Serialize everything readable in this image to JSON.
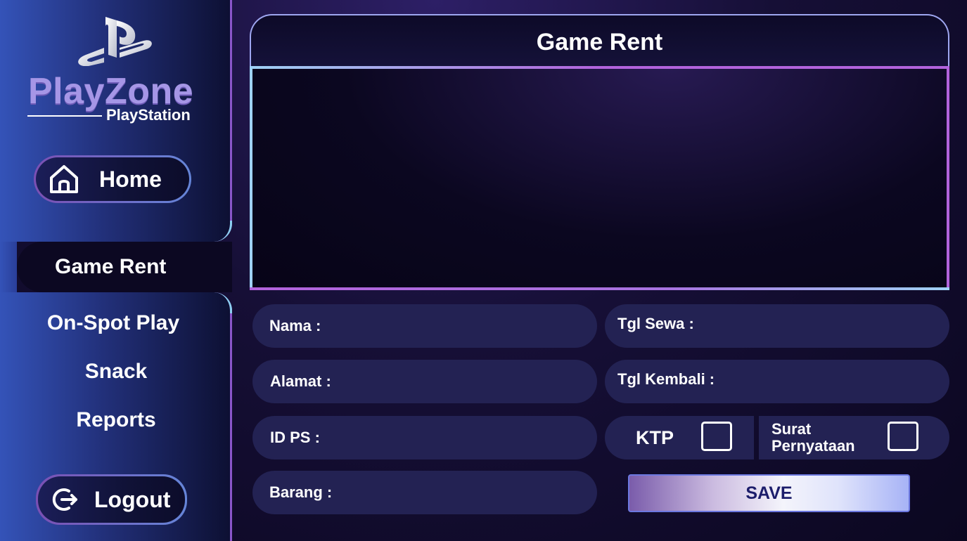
{
  "brand": {
    "logo_icon": "playstation-logo-icon",
    "name": "PlayZone",
    "subtitle": "PlayStation"
  },
  "sidebar": {
    "home": {
      "label": "Home",
      "icon": "home-icon"
    },
    "items": [
      {
        "label": "Game Rent",
        "active": true
      },
      {
        "label": "On-Spot Play",
        "active": false
      },
      {
        "label": "Snack",
        "active": false
      },
      {
        "label": "Reports",
        "active": false
      }
    ],
    "logout": {
      "label": "Logout",
      "icon": "logout-icon"
    }
  },
  "main": {
    "title": "Game Rent",
    "form": {
      "nama_label": "Nama :",
      "alamat_label": "Alamat :",
      "idps_label": "ID PS :",
      "barang_label": "Barang :",
      "tgl_sewa_label": "Tgl Sewa :",
      "tgl_kembali_label": "Tgl Kembali :",
      "ktp_label": "KTP",
      "ktp_checked": false,
      "surat_label_line1": "Surat",
      "surat_label_line2": "Pernyataan",
      "surat_checked": false,
      "save_label": "SAVE"
    }
  },
  "colors": {
    "sidebar_blue": "#3453b8",
    "field_bg": "#232253",
    "accent_purple": "#b263dc",
    "accent_cyan": "#9fd2f5",
    "save_text": "#1c1d6b"
  }
}
